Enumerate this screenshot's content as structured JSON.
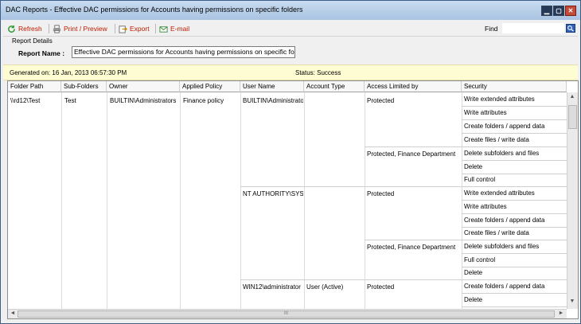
{
  "window": {
    "title": "DAC Reports - Effective DAC permissions for Accounts having permissions on specific folders",
    "min": "▁",
    "max": "▢",
    "close": "✕"
  },
  "toolbar": {
    "refresh": "Refresh",
    "print": "Print / Preview",
    "export": "Export",
    "email": "E-mail",
    "find_label": "Find",
    "find_value": ""
  },
  "details": {
    "legend": "Report Details",
    "report_name_label": "Report Name :",
    "report_name_value": "Effective DAC permissions for Accounts having permissions on specific fo"
  },
  "status": {
    "generated": "Generated on: 16 Jan, 2013 06:57:30 PM",
    "status": "Status: Success"
  },
  "columns": [
    "Folder Path",
    "Sub-Folders",
    "Owner",
    "Applied Policy",
    "User Name",
    "Account Type",
    "Access Limited by",
    "Security"
  ],
  "row": {
    "folder_path": "\\\\rd12\\Test",
    "sub_folders": "Test",
    "owner": "BUILTIN\\Administrators",
    "applied_policy": "Finance policy"
  },
  "users": [
    {
      "name": "BUILTIN\\Administrators",
      "account_type": ""
    },
    {
      "name": "NT AUTHORITY\\SYSTEM",
      "account_type": ""
    },
    {
      "name": "WIN12\\administrator",
      "account_type": "User (Active)"
    }
  ],
  "access_groups": [
    {
      "label": "Protected"
    },
    {
      "label": "Protected, Finance Department"
    },
    {
      "label": "Protected"
    },
    {
      "label": "Protected, Finance Department"
    },
    {
      "label": "Protected"
    }
  ],
  "security": [
    "Write extended attributes",
    "Write attributes",
    "Create folders / append data",
    "Create files / write data",
    "Delete subfolders and files",
    "Delete",
    "Full control",
    "Write extended attributes",
    "Write attributes",
    "Create folders / append data",
    "Create files / write data",
    "Delete subfolders and files",
    "Full control",
    "Delete",
    "Create folders / append data",
    "Delete"
  ],
  "scroll": {
    "up": "▲",
    "down": "▼",
    "left": "◄",
    "right": "►",
    "grip": "III"
  },
  "colors": {
    "accent_red": "#c01a00",
    "status_bg": "#fefcd2",
    "title_bg": "#a9c3e2"
  }
}
